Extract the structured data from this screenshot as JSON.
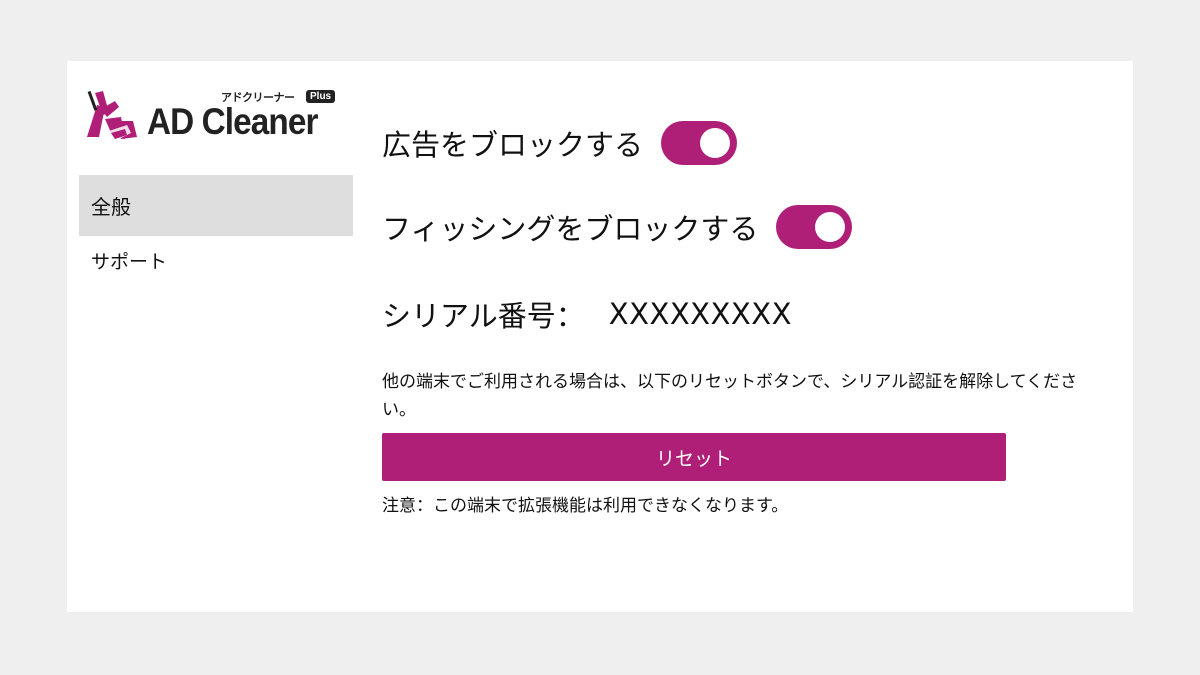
{
  "app": {
    "logo_text": "AD Cleaner",
    "logo_kana": "アドクリーナー",
    "logo_badge": "Plus",
    "brand_color": "#b01f77"
  },
  "sidebar": {
    "items": [
      {
        "label": "全般",
        "active": true
      },
      {
        "label": "サポート",
        "active": false
      }
    ]
  },
  "settings": {
    "block_ads": {
      "label": "広告をブロックする",
      "enabled": true
    },
    "block_phishing": {
      "label": "フィッシングをブロックする",
      "enabled": true
    }
  },
  "serial": {
    "label": "シリアル番号：",
    "value": "XXXXXXXXX"
  },
  "reset": {
    "note": "他の端末でご利用される場合は、以下のリセットボタンで、シリアル認証を解除してください。",
    "button_label": "リセット",
    "warning": "注意：この端末で拡張機能は利用できなくなります。"
  }
}
